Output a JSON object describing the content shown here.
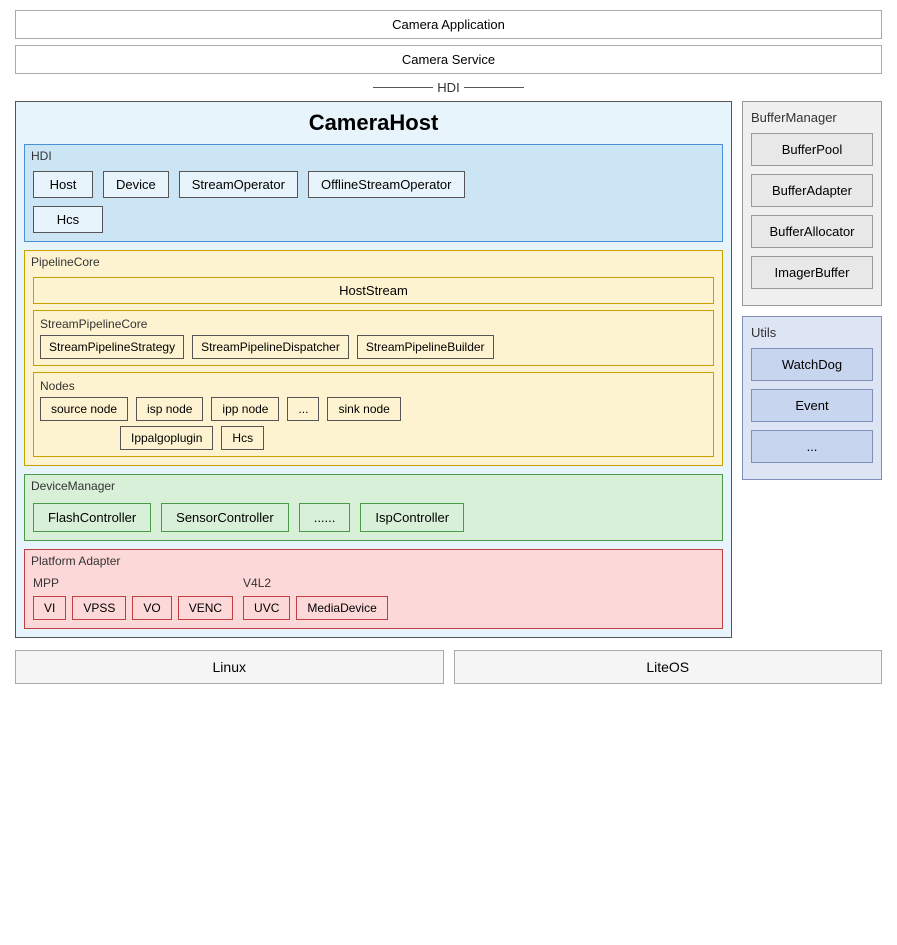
{
  "header": {
    "camera_application": "Camera Application",
    "camera_service": "Camera Service",
    "hdi_connector": "HDI"
  },
  "camera_host": {
    "title": "CameraHost",
    "hdi_label": "HDI",
    "hdi_items": [
      "Host",
      "Device",
      "StreamOperator",
      "OfflineStreamOperator"
    ],
    "hcs_label": "Hcs"
  },
  "pipeline_core": {
    "label": "PipelineCore",
    "host_stream": "HostStream",
    "stream_pipeline_core_label": "StreamPipelineCore",
    "stream_items": [
      "StreamPipelineStrategy",
      "StreamPipelineDispatcher",
      "StreamPipelineBuilder"
    ],
    "nodes_label": "Nodes",
    "nodes": [
      "source node",
      "isp node",
      "ipp node",
      "...",
      "sink node"
    ],
    "nodes_sub": [
      "Ippalgoplugin",
      "Hcs"
    ]
  },
  "device_manager": {
    "label": "DeviceManager",
    "items": [
      "FlashController",
      "SensorController",
      "......",
      "IspController"
    ]
  },
  "platform_adapter": {
    "label": "Platform Adapter",
    "mpp_label": "MPP",
    "mpp_items": [
      "VI",
      "VPSS",
      "VO",
      "VENC"
    ],
    "v4l2_label": "V4L2",
    "v4l2_items": [
      "UVC",
      "MediaDevice"
    ]
  },
  "buffer_manager": {
    "title": "BufferManager",
    "items": [
      "BufferPool",
      "BufferAdapter",
      "BufferAllocator",
      "ImagerBuffer"
    ]
  },
  "utils": {
    "title": "Utils",
    "items": [
      "WatchDog",
      "Event",
      "..."
    ]
  },
  "bottom": {
    "linux": "Linux",
    "liteos": "LiteOS"
  }
}
